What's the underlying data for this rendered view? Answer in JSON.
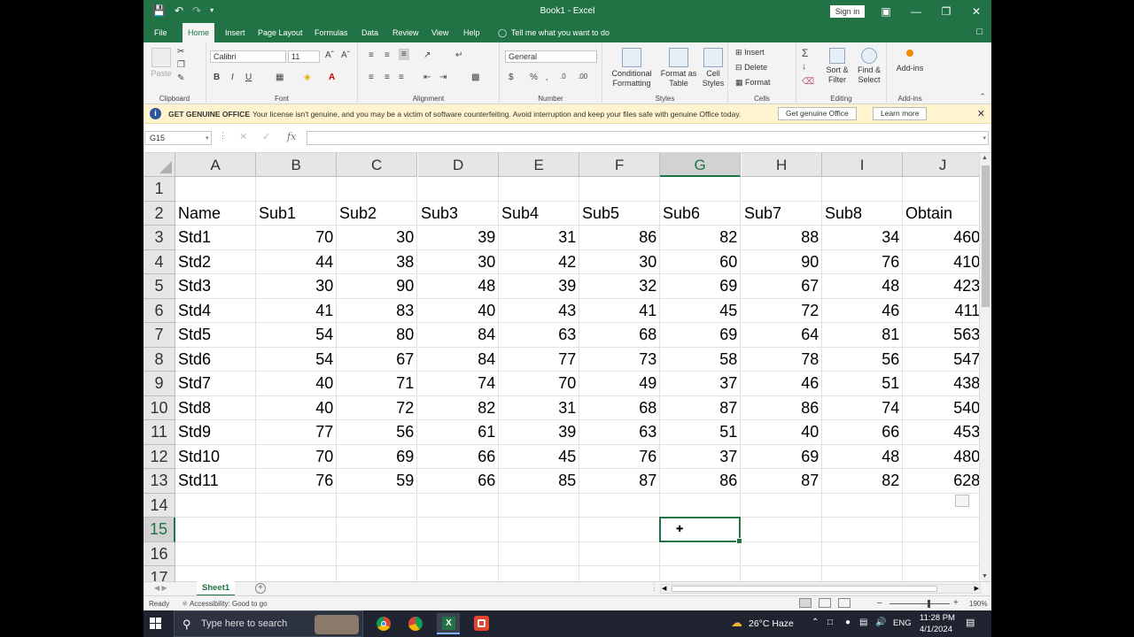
{
  "window": {
    "title": "Book1 - Excel",
    "sign_in": "Sign in"
  },
  "tabs": [
    "File",
    "Home",
    "Insert",
    "Page Layout",
    "Formulas",
    "Data",
    "Review",
    "View",
    "Help"
  ],
  "active_tab": "Home",
  "tell_me": "Tell me what you want to do",
  "ribbon": {
    "clipboard": {
      "paste": "Paste",
      "label": "Clipboard"
    },
    "font": {
      "name": "Calibri",
      "size": "11",
      "label": "Font"
    },
    "alignment": {
      "label": "Alignment"
    },
    "number": {
      "format": "General",
      "label": "Number"
    },
    "styles": {
      "conditional_formatting": "Conditional Formatting",
      "format_as_table": "Format as Table",
      "cell_styles": "Cell Styles",
      "label": "Styles"
    },
    "cells": {
      "insert": "Insert",
      "delete": "Delete",
      "format": "Format",
      "label": "Cells"
    },
    "editing": {
      "sort_filter": "Sort & Filter",
      "find_select": "Find & Select",
      "label": "Editing"
    },
    "addins": {
      "button": "Add-ins",
      "label": "Add-ins"
    }
  },
  "message_bar": {
    "title": "GET GENUINE OFFICE",
    "text": "Your license isn't genuine, and you may be a victim of software counterfeiting. Avoid interruption and keep your files safe with genuine Office today.",
    "primary_button": "Get genuine Office",
    "secondary_button": "Learn more"
  },
  "formula_bar": {
    "name_box": "G15",
    "formula": ""
  },
  "sheet": {
    "columns": [
      "A",
      "B",
      "C",
      "D",
      "E",
      "F",
      "G",
      "H",
      "I",
      "J"
    ],
    "selected_column": "G",
    "row_numbers": [
      1,
      2,
      3,
      4,
      5,
      6,
      7,
      8,
      9,
      10,
      11,
      12,
      13,
      14,
      15,
      16,
      17
    ],
    "selected_row": 15,
    "rows": [
      [],
      [
        "Name",
        "Sub1",
        "Sub2",
        "Sub3",
        "Sub4",
        "Sub5",
        "Sub6",
        "Sub7",
        "Sub8",
        "Obtain"
      ],
      [
        "Std1",
        "70",
        "30",
        "39",
        "31",
        "86",
        "82",
        "88",
        "34",
        "460"
      ],
      [
        "Std2",
        "44",
        "38",
        "30",
        "42",
        "30",
        "60",
        "90",
        "76",
        "410"
      ],
      [
        "Std3",
        "30",
        "90",
        "48",
        "39",
        "32",
        "69",
        "67",
        "48",
        "423"
      ],
      [
        "Std4",
        "41",
        "83",
        "40",
        "43",
        "41",
        "45",
        "72",
        "46",
        "411"
      ],
      [
        "Std5",
        "54",
        "80",
        "84",
        "63",
        "68",
        "69",
        "64",
        "81",
        "563"
      ],
      [
        "Std6",
        "54",
        "67",
        "84",
        "77",
        "73",
        "58",
        "78",
        "56",
        "547"
      ],
      [
        "Std7",
        "40",
        "71",
        "74",
        "70",
        "49",
        "37",
        "46",
        "51",
        "438"
      ],
      [
        "Std8",
        "40",
        "72",
        "82",
        "31",
        "68",
        "87",
        "86",
        "74",
        "540"
      ],
      [
        "Std9",
        "77",
        "56",
        "61",
        "39",
        "63",
        "51",
        "40",
        "66",
        "453"
      ],
      [
        "Std10",
        "70",
        "69",
        "66",
        "45",
        "76",
        "37",
        "69",
        "48",
        "480"
      ],
      [
        "Std11",
        "76",
        "59",
        "66",
        "85",
        "87",
        "86",
        "87",
        "82",
        "628"
      ],
      [],
      [],
      [],
      []
    ],
    "tab_name": "Sheet1"
  },
  "status_bar": {
    "ready": "Ready",
    "accessibility": "Accessibility: Good to go",
    "zoom": "190%"
  },
  "taskbar": {
    "search_placeholder": "Type here to search",
    "weather": "26°C  Haze",
    "language": "ENG",
    "time": "11:28 PM",
    "date": "4/1/2024"
  },
  "colors": {
    "excel_green": "#217346",
    "message_bar": "#fff4ce",
    "taskbar": "#1f2430"
  }
}
